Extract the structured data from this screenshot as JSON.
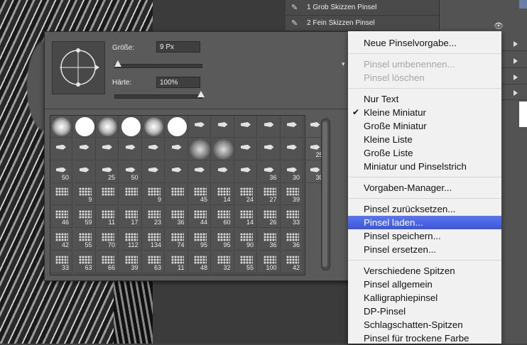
{
  "brush_list": [
    {
      "label": "1 Grob Skizzen Pinsel"
    },
    {
      "label": "2 Fein Skizzen Pinsel"
    }
  ],
  "picker": {
    "size_label": "Größe:",
    "size_value": "9 Px",
    "size_slider_fraction": 0.03,
    "hardness_label": "Härte:",
    "hardness_value": "100%",
    "hardness_slider_fraction": 1.0
  },
  "brush_rows": [
    [
      "",
      "",
      "",
      "",
      "",
      "",
      "",
      "",
      "",
      "",
      "",
      ""
    ],
    [
      "",
      "",
      "",
      "",
      "",
      "",
      "",
      "",
      "",
      "",
      "",
      "25"
    ],
    [
      "50",
      "",
      "25",
      "50",
      "",
      "",
      "",
      "",
      "",
      "36",
      "30",
      "30"
    ],
    [
      "",
      "9",
      "",
      "",
      "9",
      "",
      "45",
      "14",
      "24",
      "27",
      "39"
    ],
    [
      "46",
      "59",
      "11",
      "17",
      "23",
      "36",
      "44",
      "60",
      "14",
      "26",
      "33"
    ],
    [
      "42",
      "55",
      "70",
      "112",
      "134",
      "74",
      "95",
      "95",
      "90",
      "36",
      "36"
    ],
    [
      "33",
      "63",
      "66",
      "39",
      "63",
      "11",
      "48",
      "32",
      "55",
      "100",
      "42"
    ]
  ],
  "menu": {
    "groups": [
      [
        {
          "label": "Neue Pinselvorgabe...",
          "enabled": true
        }
      ],
      [
        {
          "label": "Pinsel umbenennen...",
          "enabled": false
        },
        {
          "label": "Pinsel löschen",
          "enabled": false
        }
      ],
      [
        {
          "label": "Nur Text",
          "enabled": true
        },
        {
          "label": "Kleine Miniatur",
          "enabled": true,
          "checked": true
        },
        {
          "label": "Große Miniatur",
          "enabled": true
        },
        {
          "label": "Kleine Liste",
          "enabled": true
        },
        {
          "label": "Große Liste",
          "enabled": true
        },
        {
          "label": "Miniatur und Pinselstrich",
          "enabled": true
        }
      ],
      [
        {
          "label": "Vorgaben-Manager...",
          "enabled": true
        }
      ],
      [
        {
          "label": "Pinsel zurücksetzen...",
          "enabled": true
        },
        {
          "label": "Pinsel laden...",
          "enabled": true,
          "selected": true
        },
        {
          "label": "Pinsel speichern...",
          "enabled": true
        },
        {
          "label": "Pinsel ersetzen...",
          "enabled": true
        }
      ],
      [
        {
          "label": "Verschiedene Spitzen",
          "enabled": true
        },
        {
          "label": "Pinsel allgemein",
          "enabled": true
        },
        {
          "label": "Kalligraphiepinsel",
          "enabled": true
        },
        {
          "label": "DP-Pinsel",
          "enabled": true
        },
        {
          "label": "Schlagschatten-Spitzen",
          "enabled": true
        },
        {
          "label": "Pinsel für trockene Farbe",
          "enabled": true
        }
      ]
    ]
  },
  "icons": {
    "brush_item": "brush-icon",
    "settings": "gear-icon",
    "preset_caret": "chevron-down-icon",
    "checkmark": "checkmark-icon",
    "layer_visibility": "eye-icon",
    "layer_group": "folder-icon"
  },
  "colors": {
    "menu_highlight": "#4d66dd",
    "panel_bg": "#5a5a5a",
    "menu_bg": "#f1f1f1"
  }
}
